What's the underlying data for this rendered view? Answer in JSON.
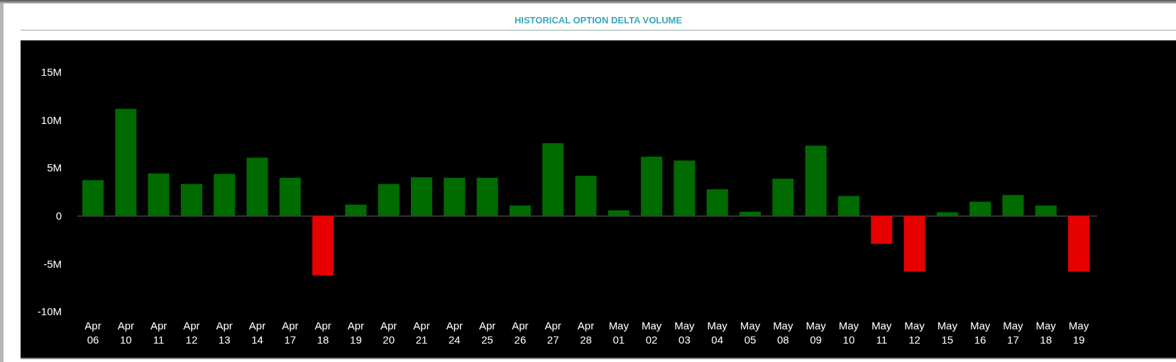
{
  "title": "HISTORICAL OPTION DELTA VOLUME",
  "chart": {
    "chart_data": {
      "type": "bar",
      "categories": [
        "Apr 06",
        "Apr 10",
        "Apr 11",
        "Apr 12",
        "Apr 13",
        "Apr 14",
        "Apr 17",
        "Apr 18",
        "Apr 19",
        "Apr 20",
        "Apr 21",
        "Apr 24",
        "Apr 25",
        "Apr 26",
        "Apr 27",
        "Apr 28",
        "May 01",
        "May 02",
        "May 03",
        "May 04",
        "May 05",
        "May 08",
        "May 09",
        "May 10",
        "May 11",
        "May 12",
        "May 15",
        "May 16",
        "May 17",
        "May 18",
        "May 19"
      ],
      "values": [
        3.75,
        11.2,
        4.45,
        3.35,
        4.4,
        6.1,
        4.0,
        -6.2,
        1.2,
        3.35,
        4.05,
        4.0,
        4.0,
        1.1,
        7.6,
        4.2,
        0.6,
        6.2,
        5.8,
        2.8,
        0.45,
        3.9,
        7.35,
        2.1,
        -2.9,
        -5.8,
        0.4,
        1.5,
        2.2,
        1.1,
        -5.8
      ],
      "ylim": [
        -10,
        15
      ],
      "yticks": [
        {
          "value": 15,
          "label": "15M"
        },
        {
          "value": 10,
          "label": "10M"
        },
        {
          "value": 5,
          "label": "5M"
        },
        {
          "value": 0,
          "label": "0"
        },
        {
          "value": -5,
          "label": "-5M"
        },
        {
          "value": -10,
          "label": "-10M"
        }
      ]
    }
  }
}
